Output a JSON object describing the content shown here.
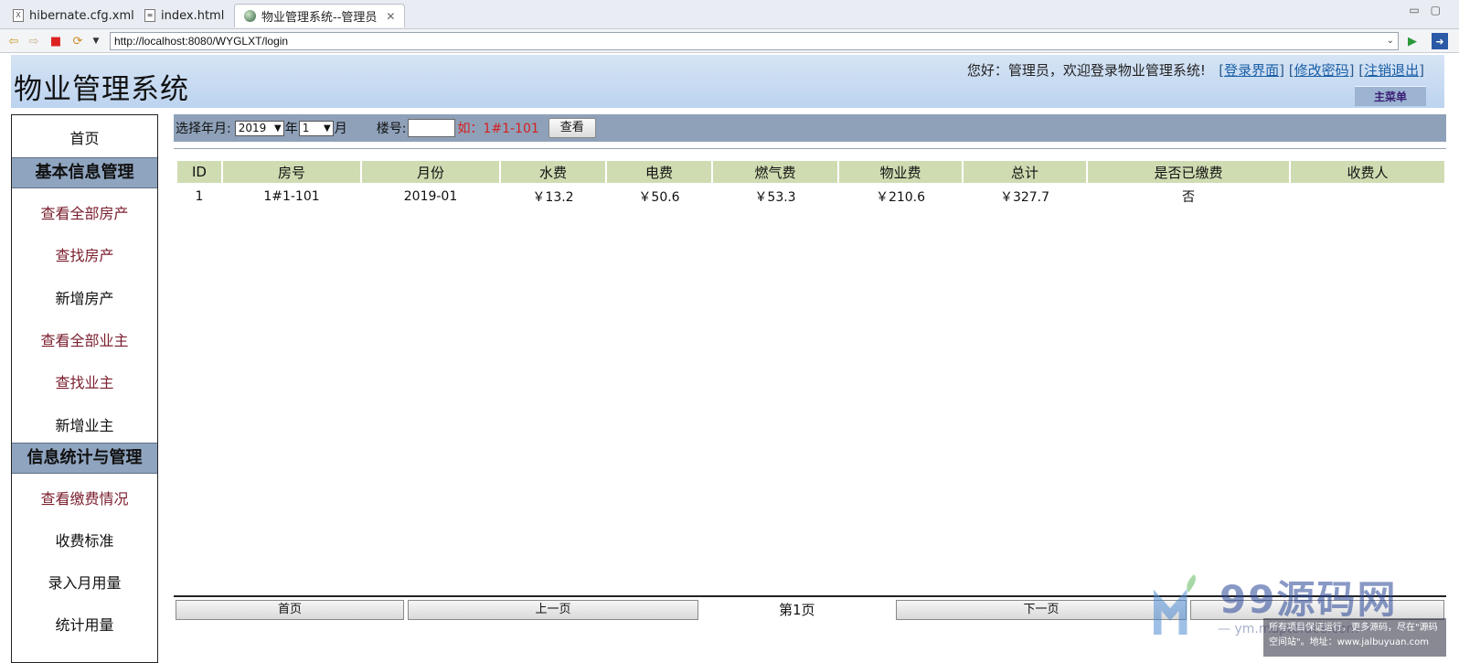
{
  "tabs": [
    {
      "label": "hibernate.cfg.xml",
      "icon": "xml-file-icon"
    },
    {
      "label": "index.html",
      "icon": "html-file-icon"
    },
    {
      "label": "物业管理系统--管理员",
      "icon": "globe-icon",
      "active": true
    }
  ],
  "browser": {
    "url": "http://localhost:8080/WYGLXT/login"
  },
  "header": {
    "title": "物业管理系统",
    "welcome": "您好：管理员，欢迎登录物业管理系统!",
    "links": [
      "登录界面",
      "修改密码",
      "注销退出"
    ],
    "main_menu": "主菜单"
  },
  "sidebar": {
    "home": "首页",
    "section1": "基本信息管理",
    "items1": [
      "查看全部房产",
      "查找房产",
      "新增房产",
      "查看全部业主",
      "查找业主",
      "新增业主"
    ],
    "section2": "信息统计与管理",
    "items2": [
      "查看缴费情况",
      "收费标准",
      "录入月用量",
      "统计用量"
    ]
  },
  "filter": {
    "label_ym": "选择年月:",
    "year": "2019",
    "year_suffix": "年",
    "month": "1",
    "month_suffix": "月",
    "label_building": "楼号:",
    "building_value": "",
    "hint": "如：1#1-101",
    "button": "查看"
  },
  "table": {
    "headers": [
      "ID",
      "房号",
      "月份",
      "水费",
      "电费",
      "燃气费",
      "物业费",
      "总计",
      "是否已缴费",
      "收费人"
    ],
    "rows": [
      [
        "1",
        "1#1-101",
        "2019-01",
        "￥13.2",
        "￥50.6",
        "￥53.3",
        "￥210.6",
        "￥327.7",
        "否",
        ""
      ]
    ]
  },
  "pager": {
    "first": "首页",
    "prev": "上一页",
    "current": "第1页",
    "next": "下一页",
    "last": ""
  },
  "watermark": {
    "brand": "99源码网",
    "sub": "— ym.maptoface.com —",
    "note": "所有项目保证运行，更多源码，尽在\"源码空间站\"。地址：www.jalbuyuan.com"
  },
  "colors": {
    "header_bg": "#bcd3ef",
    "filter_bg": "#8ea1b9",
    "section_bg": "#8fa4bf",
    "table_head_bg": "#cfdcb2",
    "hint_red": "#d61f1f",
    "link_maroon": "#7a1e2c"
  }
}
